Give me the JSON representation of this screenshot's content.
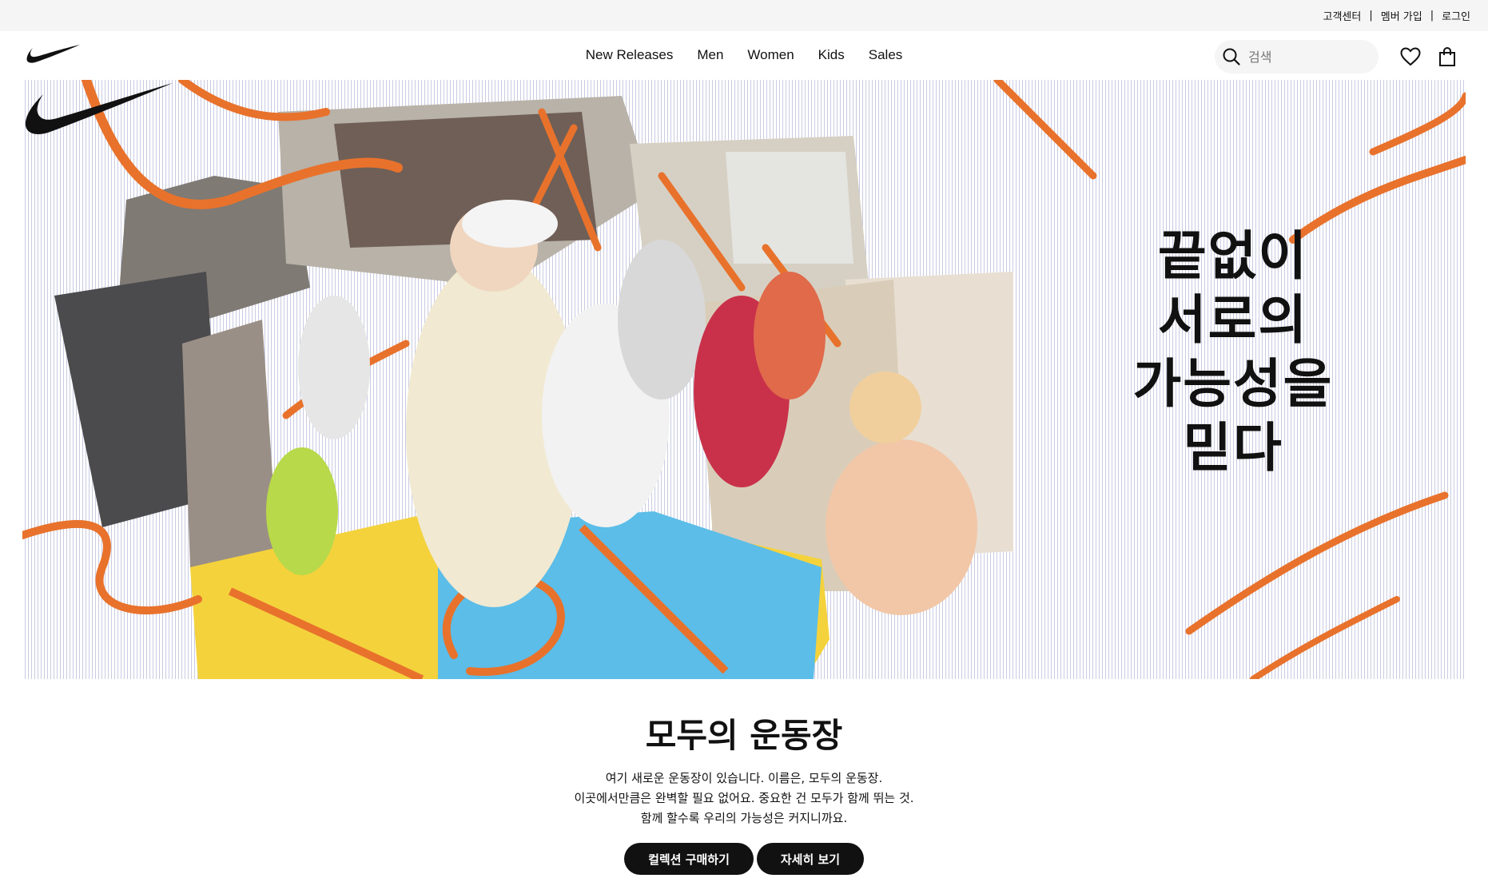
{
  "utility": {
    "links": [
      "고객센터",
      "멤버 가입",
      "로그인"
    ],
    "separator": "|"
  },
  "header": {
    "logo_icon": "nike-swoosh-icon",
    "nav": [
      "New Releases",
      "Men",
      "Women",
      "Kids",
      "Sales"
    ],
    "search_placeholder": "검색",
    "search_icon": "search-icon",
    "favorites_icon": "heart-icon",
    "bag_icon": "shopping-bag-icon"
  },
  "hero": {
    "heading_lines": [
      "끝없이",
      "서로의",
      "가능성을",
      "믿다"
    ],
    "brand_icon": "nike-swoosh-icon",
    "colors": {
      "accent": "#e8722c",
      "court_blue": "#5bbde8",
      "court_yellow": "#f4d23c"
    }
  },
  "content": {
    "title": "모두의 운동장",
    "description": [
      "여기 새로운 운동장이 있습니다. 이름은, 모두의 운동장.",
      "이곳에서만큼은 완벽할 필요 없어요. 중요한 건 모두가 함께 뛰는 것.",
      "함께 할수록 우리의 가능성은 커지니까요."
    ],
    "buttons": {
      "shop": "컬렉션 구매하기",
      "more": "자세히 보기"
    }
  }
}
